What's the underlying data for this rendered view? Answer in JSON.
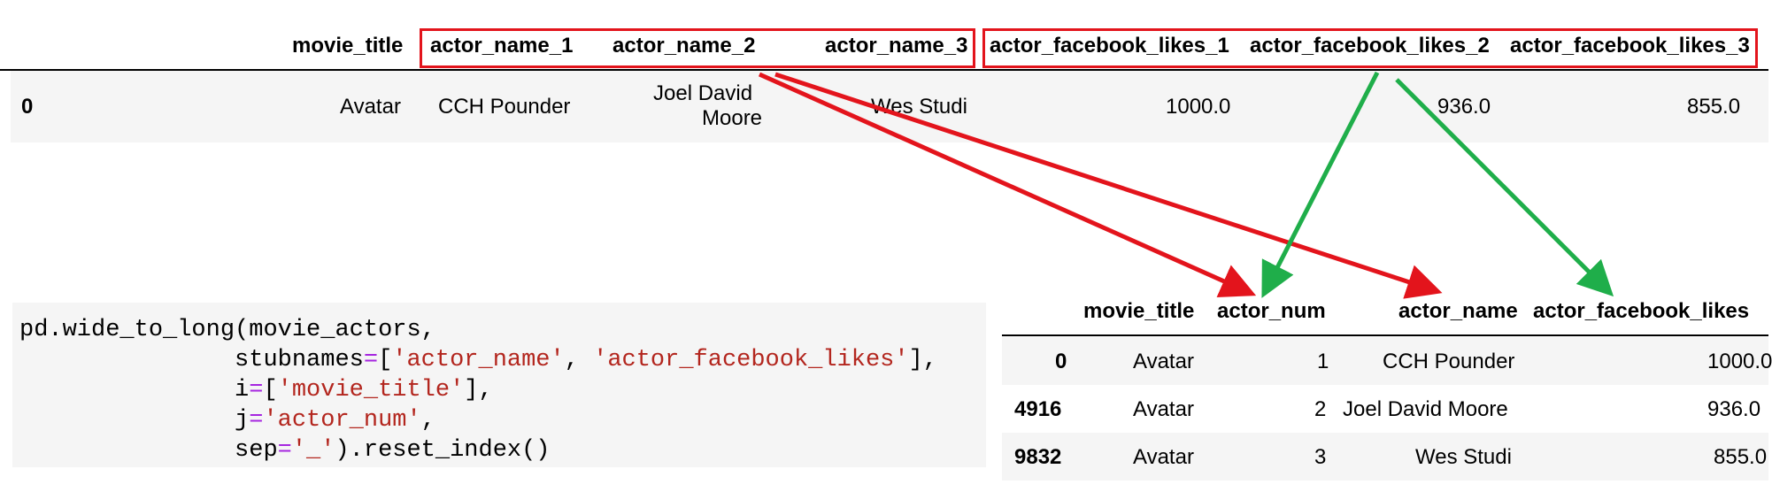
{
  "wide_table": {
    "headers": [
      "movie_title",
      "actor_name_1",
      "actor_name_2",
      "actor_name_3",
      "actor_facebook_likes_1",
      "actor_facebook_likes_2",
      "actor_facebook_likes_3"
    ],
    "row": {
      "index": "0",
      "movie_title": "Avatar",
      "actor_name_1": "CCH Pounder",
      "actor_name_2_line1": "Joel David",
      "actor_name_2_line2": "Moore",
      "actor_name_3": "Wes Studi",
      "actor_facebook_likes_1": "1000.0",
      "actor_facebook_likes_2": "936.0",
      "actor_facebook_likes_3": "855.0"
    }
  },
  "code": {
    "func": "pd.wide_to_long(movie_actors,",
    "stubnames_key": "stubnames",
    "eq": "=",
    "stub1": "'actor_name'",
    "stub2": "'actor_facebook_likes'",
    "i_key": "i",
    "i_val": "'movie_title'",
    "j_key": "j",
    "j_val": "'actor_num'",
    "sep_key": "sep",
    "sep_val": "'_'",
    "tail": ").reset_index()",
    "open_bracket": "[",
    "close_bracket_comma": "],",
    "comma_space": ", ",
    "comma": ","
  },
  "long_table": {
    "headers": [
      "movie_title",
      "actor_num",
      "actor_name",
      "actor_facebook_likes"
    ],
    "rows": [
      {
        "index": "0",
        "movie_title": "Avatar",
        "actor_num": "1",
        "actor_name": "CCH Pounder",
        "likes": "1000.0"
      },
      {
        "index": "4916",
        "movie_title": "Avatar",
        "actor_num": "2",
        "actor_name": "Joel David Moore",
        "likes": "936.0"
      },
      {
        "index": "9832",
        "movie_title": "Avatar",
        "actor_num": "3",
        "actor_name": "Wes Studi",
        "likes": "855.0"
      }
    ]
  },
  "colors": {
    "highlight": "#e3141c",
    "green_arrow": "#1fae4a",
    "red_arrow": "#e3141c"
  }
}
